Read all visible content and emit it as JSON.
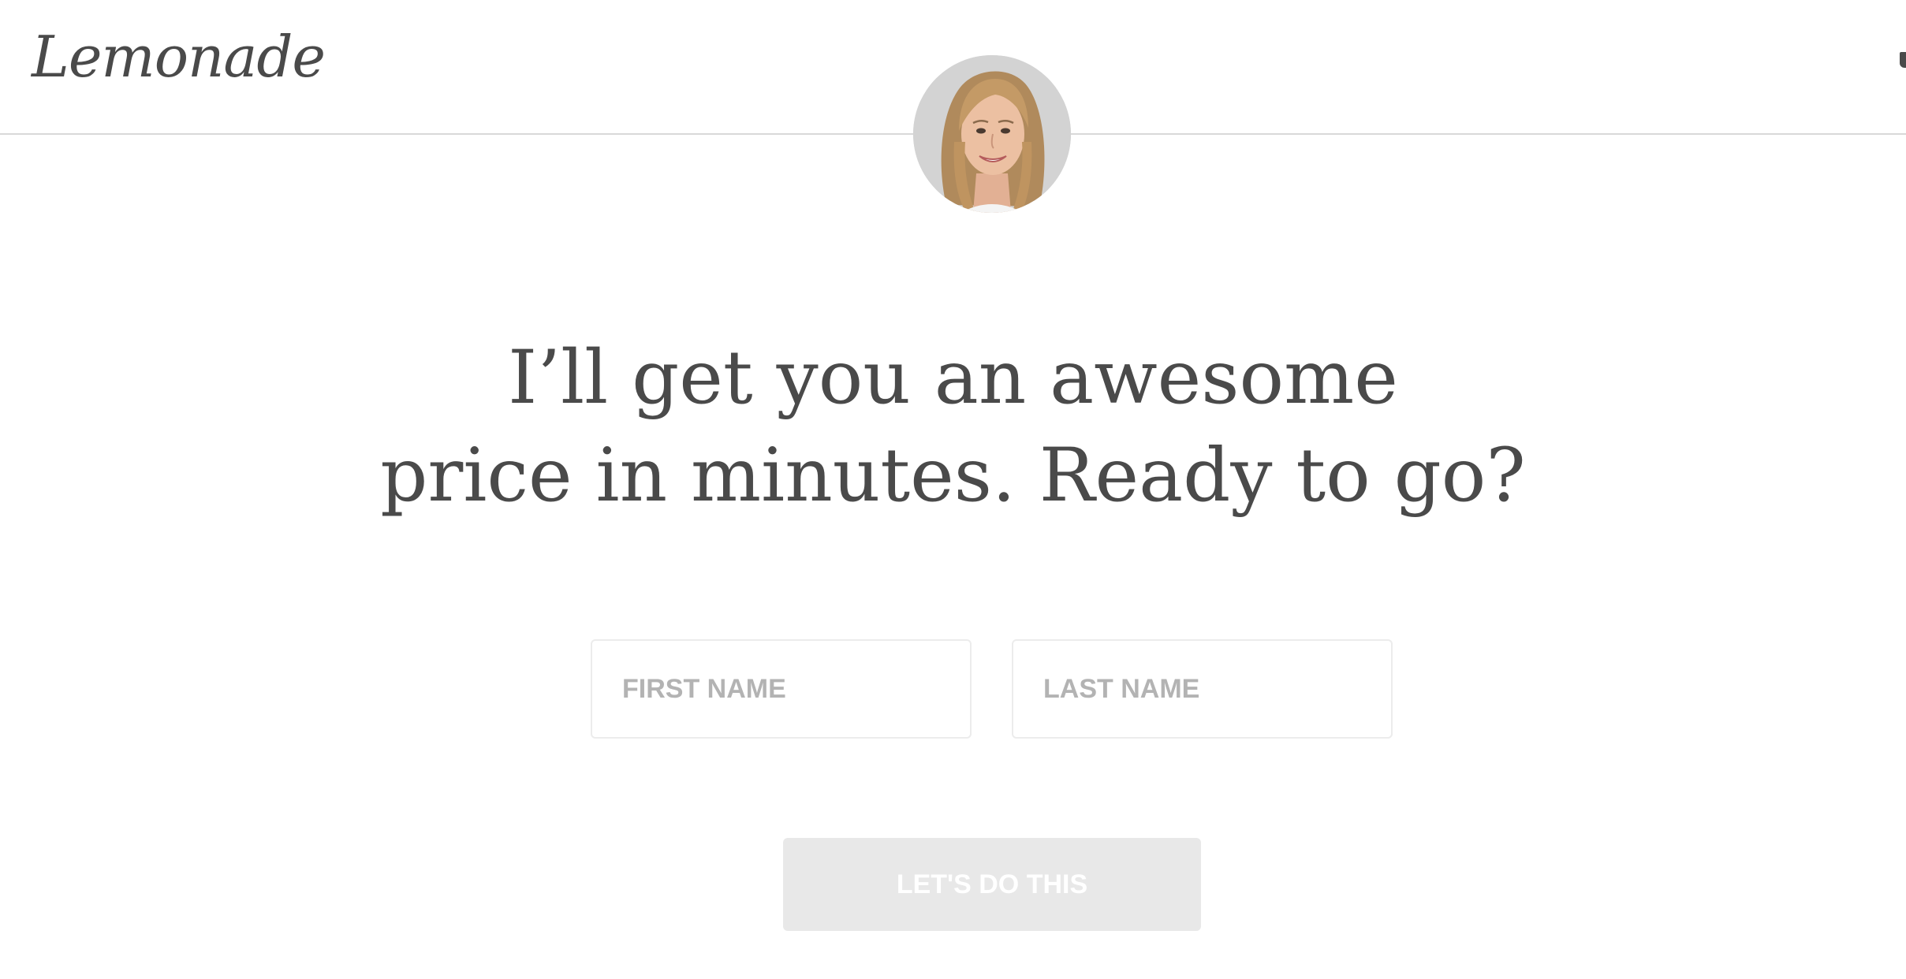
{
  "header": {
    "logo_text": "Lemonade"
  },
  "avatar": {
    "icon": "assistant-avatar-photo"
  },
  "headline": {
    "line1": "I’ll get you an awesome",
    "line2": "price in minutes. Ready to go?"
  },
  "form": {
    "first_name_placeholder": "FIRST NAME",
    "last_name_placeholder": "LAST NAME",
    "first_name_value": "",
    "last_name_value": "",
    "submit_label": "LET'S DO THIS"
  },
  "colors": {
    "text": "#4a4a4a",
    "placeholder": "#b3b3b3",
    "button_disabled_bg": "#e8e8e8",
    "divider": "#d9d9d9"
  }
}
